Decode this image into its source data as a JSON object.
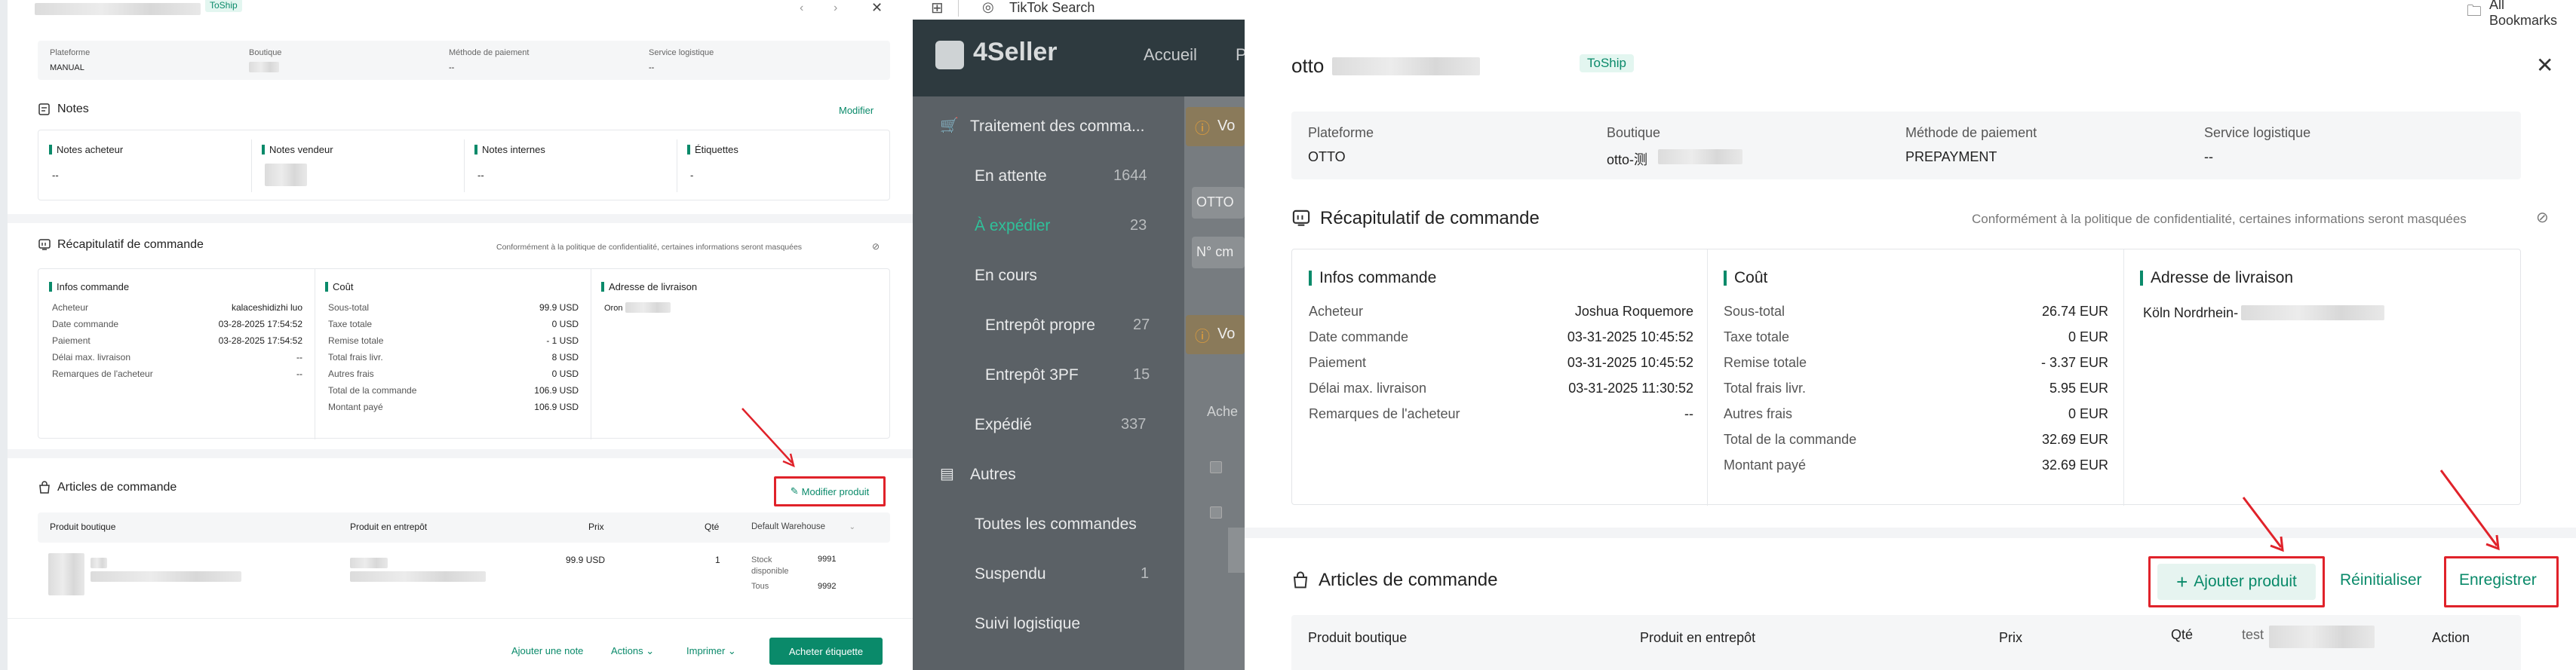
{
  "left": {
    "tag": "ToShip",
    "info": {
      "platform_label": "Plateforme",
      "platform_value": "MANUAL",
      "shop_label": "Boutique",
      "payment_label": "Méthode de paiement",
      "payment_value": "--",
      "logistics_label": "Service logistique",
      "logistics_value": "--"
    },
    "notes": {
      "title": "Notes",
      "edit": "Modifier",
      "buyer_label": "Notes acheteur",
      "buyer_value": "--",
      "seller_label": "Notes vendeur",
      "internal_label": "Notes internes",
      "internal_value": "--",
      "tags_label": "Étiquettes",
      "tags_value": "-"
    },
    "summary": {
      "title": "Récapitulatif de commande",
      "privacy": "Conformément à la politique de confidentialité, certaines informations seront masquées",
      "order_info_title": "Infos commande",
      "order_info": [
        {
          "k": "Acheteur",
          "v": "kalaceshidizhi luo"
        },
        {
          "k": "Date commande",
          "v": "03-28-2025 17:54:52"
        },
        {
          "k": "Paiement",
          "v": "03-28-2025 17:54:52"
        },
        {
          "k": "Délai max. livraison",
          "v": "--"
        },
        {
          "k": "Remarques de l'acheteur",
          "v": "--"
        }
      ],
      "cost_title": "Coût",
      "cost": [
        {
          "k": "Sous-total",
          "v": "99.9 USD"
        },
        {
          "k": "Taxe totale",
          "v": "0 USD"
        },
        {
          "k": "Remise totale",
          "v": "- 1 USD"
        },
        {
          "k": "Total frais livr.",
          "v": "8 USD"
        },
        {
          "k": "Autres frais",
          "v": "0 USD"
        },
        {
          "k": "Total de la commande",
          "v": "106.9 USD"
        },
        {
          "k": "Montant payé",
          "v": "106.9 USD"
        }
      ],
      "address_title": "Adresse de livraison",
      "address_value": "Oron"
    },
    "items": {
      "title": "Articles de commande",
      "modify_button": "Modifier produit",
      "col_shop_product": "Produit boutique",
      "col_warehouse_product": "Produit en entrepôt",
      "col_price": "Prix",
      "col_qty": "Qté",
      "warehouse_select": "Default Warehouse",
      "row_price": "99.9 USD",
      "row_qty": "1",
      "stock_label": "Stock disponible",
      "stock_value": "9991",
      "all_label": "Tous",
      "all_value": "9992"
    },
    "footer": {
      "add_note": "Ajouter une note",
      "actions": "Actions",
      "print": "Imprimer",
      "buy_label": "Acheter étiquette"
    }
  },
  "middle": {
    "browser_tab": "TikTok Search",
    "logo": "4Seller",
    "nav_home": "Accueil",
    "nav_p": "P",
    "sidebar": {
      "processing": "Traitement des comma...",
      "pending": "En attente",
      "pending_count": "1644",
      "to_ship": "À expédier",
      "to_ship_count": "23",
      "in_progress": "En cours",
      "own_warehouse": "Entrepôt propre",
      "own_warehouse_count": "27",
      "warehouse_3pf": "Entrepôt 3PF",
      "warehouse_3pf_count": "15",
      "shipped": "Expédié",
      "shipped_count": "337",
      "others": "Autres",
      "all_orders": "Toutes les commandes",
      "suspended": "Suspendu",
      "suspended_count": "1",
      "tracking": "Suivi logistique"
    },
    "content": {
      "notice1": "Vo",
      "field1": "OTTO",
      "field2": "N° cm",
      "notice2": "Vo",
      "ache": "Ache"
    }
  },
  "right": {
    "bookmarks": "All Bookmarks",
    "title": "otto",
    "tag": "ToShip",
    "info": {
      "platform_label": "Plateforme",
      "platform_value": "OTTO",
      "shop_label": "Boutique",
      "shop_value": "otto-测",
      "payment_label": "Méthode de paiement",
      "payment_value": "PREPAYMENT",
      "logistics_label": "Service logistique",
      "logistics_value": "--"
    },
    "summary": {
      "title": "Récapitulatif de commande",
      "privacy": "Conformément à la politique de confidentialité, certaines informations seront masquées",
      "order_info_title": "Infos commande",
      "order_info": [
        {
          "k": "Acheteur",
          "v": "Joshua Roquemore"
        },
        {
          "k": "Date commande",
          "v": "03-31-2025 10:45:52"
        },
        {
          "k": "Paiement",
          "v": "03-31-2025 10:45:52"
        },
        {
          "k": "Délai max. livraison",
          "v": "03-31-2025 11:30:52"
        },
        {
          "k": "Remarques de l'acheteur",
          "v": "--"
        }
      ],
      "cost_title": "Coût",
      "cost": [
        {
          "k": "Sous-total",
          "v": "26.74 EUR"
        },
        {
          "k": "Taxe totale",
          "v": "0 EUR"
        },
        {
          "k": "Remise totale",
          "v": "- 3.37 EUR"
        },
        {
          "k": "Total frais livr.",
          "v": "5.95 EUR"
        },
        {
          "k": "Autres frais",
          "v": "0 EUR"
        },
        {
          "k": "Total de la commande",
          "v": "32.69 EUR"
        },
        {
          "k": "Montant payé",
          "v": "32.69 EUR"
        }
      ],
      "address_title": "Adresse de livraison",
      "address_value": "Köln Nordrhein-"
    },
    "items": {
      "title": "Articles de commande",
      "add_button": "Ajouter produit",
      "reset_button": "Réinitialiser",
      "save_button": "Enregistrer",
      "col_shop_product": "Produit boutique",
      "col_warehouse_product": "Produit en entrepôt",
      "col_price": "Prix",
      "col_qty": "Qté",
      "col_test": "test",
      "col_action": "Action"
    }
  },
  "colors": {
    "accent": "#0a8a6a",
    "highlight": "#e0222a",
    "sidebar_dark": "#2e3a3f"
  }
}
